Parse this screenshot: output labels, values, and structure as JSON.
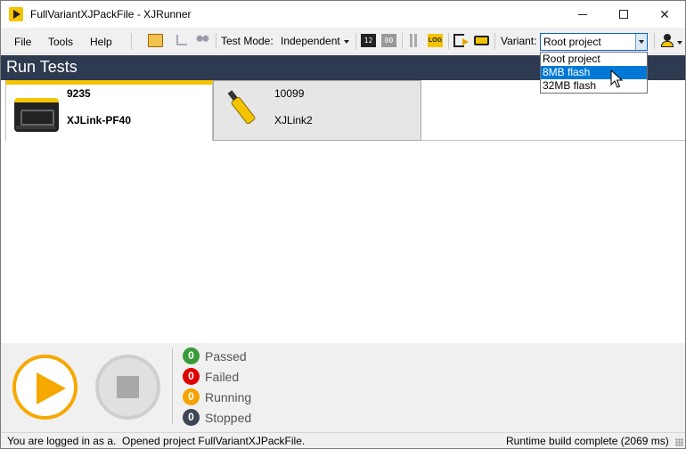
{
  "window": {
    "title": "FullVariantXJPackFile - XJRunner"
  },
  "menu": {
    "file": "File",
    "tools": "Tools",
    "help": "Help"
  },
  "toolbar": {
    "test_mode_label": "Test Mode:",
    "test_mode_value": "Independent",
    "log_icon_text": "LOG",
    "counter_icon_1": "12",
    "counter_icon_2": "00",
    "variant_label": "Variant:",
    "variant_value": "Root project"
  },
  "variant_options": [
    "Root project",
    "8MB flash",
    "32MB flash"
  ],
  "section": {
    "title": "Run Tests"
  },
  "devices": [
    {
      "serial": "9235",
      "name": "XJLink-PF40",
      "selected": true
    },
    {
      "serial": "10099",
      "name": "XJLink2",
      "selected": false
    }
  ],
  "results": [
    {
      "count": "0",
      "label": "Passed",
      "color": "#3a9a3a"
    },
    {
      "count": "0",
      "label": "Failed",
      "color": "#e00000"
    },
    {
      "count": "0",
      "label": "Running",
      "color": "#f5a300"
    },
    {
      "count": "0",
      "label": "Stopped",
      "color": "#3c4656"
    }
  ],
  "status_bar": {
    "login": "You are logged in as a.",
    "project": "Opened project FullVariantXJPackFile.",
    "runtime": "Runtime build complete (2069 ms)"
  },
  "colors": {
    "accent": "#f5c400",
    "header_bg": "#2e3a4f",
    "selection": "#0078d7"
  }
}
